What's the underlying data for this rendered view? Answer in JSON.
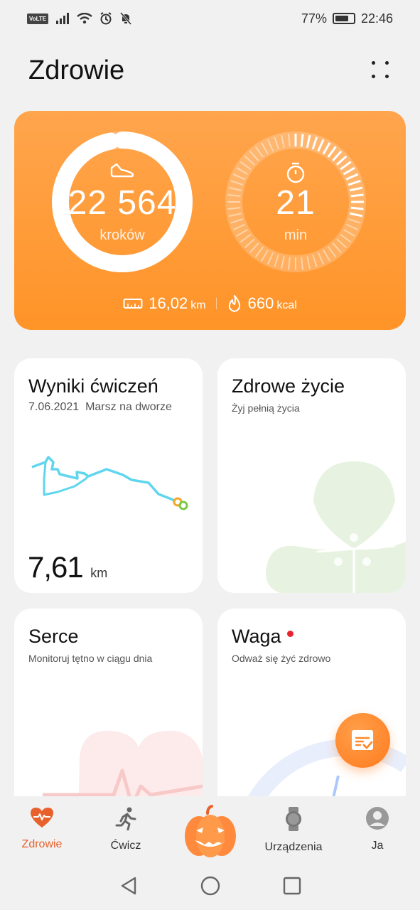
{
  "status": {
    "volte": "VoLTE",
    "battery": "77%",
    "battery_level": 0.77,
    "time": "22:46"
  },
  "header": {
    "title": "Zdrowie"
  },
  "activity": {
    "steps_value": "22 564",
    "steps_unit": "kroków",
    "steps_progress": 0.97,
    "minutes_value": "21",
    "minutes_unit": "min",
    "minutes_progress": 0.3,
    "distance_value": "16,02",
    "distance_unit": "km",
    "calories_value": "660",
    "calories_unit": "kcal"
  },
  "cards": {
    "exercise": {
      "title": "Wyniki ćwiczeń",
      "date": "7.06.2021",
      "type": "Marsz na dworze",
      "distance_value": "7,61",
      "distance_unit": "km"
    },
    "healthy": {
      "title": "Zdrowe życie",
      "subtitle": "Żyj pełnią życia"
    },
    "heart": {
      "title": "Serce",
      "subtitle": "Monitoruj tętno w ciągu dnia"
    },
    "weight": {
      "title": "Waga",
      "subtitle": "Odważ się żyć zdrowo"
    }
  },
  "nav": {
    "items": [
      {
        "label": "Zdrowie",
        "icon": "heart-pulse-icon"
      },
      {
        "label": "Ćwicz",
        "icon": "running-icon"
      },
      {
        "label": "",
        "icon": "pumpkin-icon"
      },
      {
        "label": "Urządzenia",
        "icon": "watch-icon"
      },
      {
        "label": "Ja",
        "icon": "avatar-icon"
      }
    ]
  },
  "colors": {
    "accent": "#ff9428",
    "active_nav": "#e8602c",
    "route": "#5fd6ee"
  }
}
